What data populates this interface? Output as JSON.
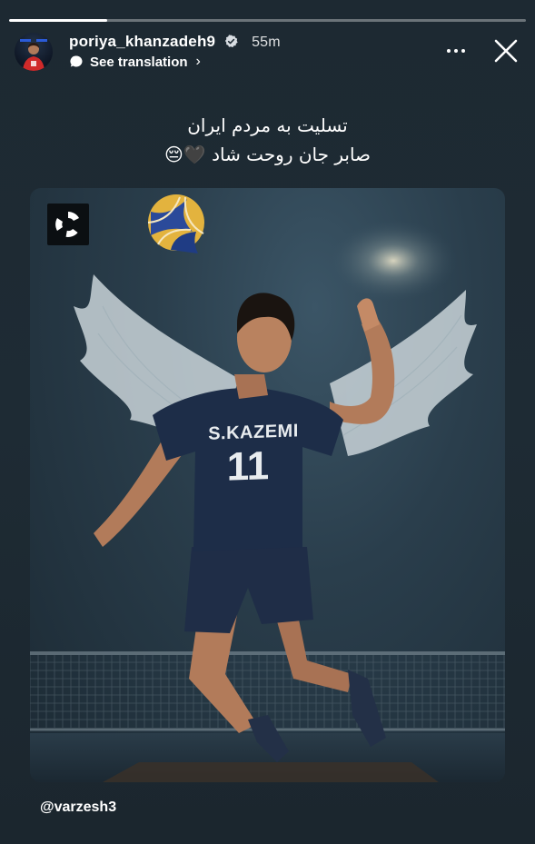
{
  "story": {
    "progress_fraction": 0.19,
    "user": {
      "username": "poriya_khanzadeh9",
      "verified": true,
      "posted_ago": "55m"
    },
    "see_translation_label": "See translation",
    "caption": {
      "line1": "تسلیت به مردم ایران",
      "line2": "صابر جان روحت شاد 🖤😔"
    },
    "image": {
      "jersey_name": "S.KAZEMI",
      "jersey_number": "11"
    },
    "mention": "@varzesh3"
  },
  "icons": {
    "more": "more-horizontal-icon",
    "close": "close-icon",
    "translate": "translate-bubble-icon",
    "chevron": "chevron-right-icon",
    "verified": "verified-badge-icon"
  },
  "colors": {
    "background": "#1e2a33",
    "text": "#ffffff",
    "jersey": "#1d2d48"
  }
}
